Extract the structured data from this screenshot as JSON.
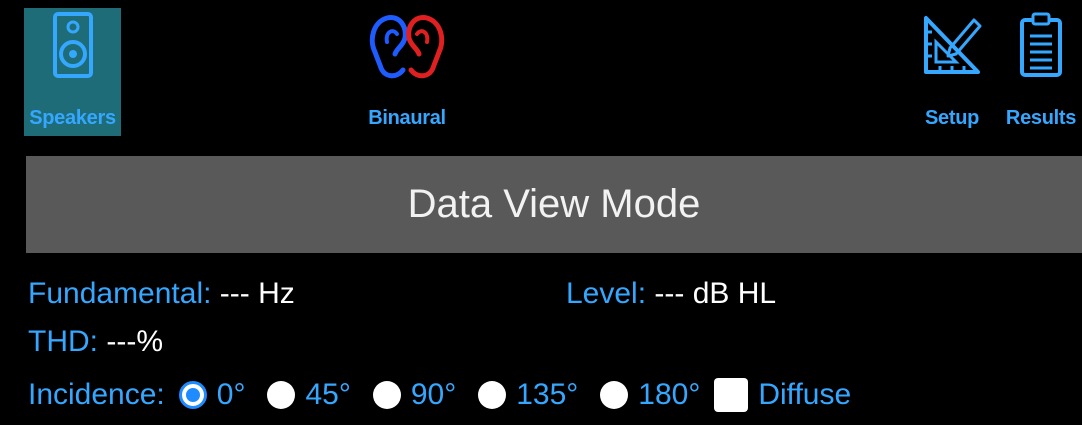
{
  "nav": {
    "speakers": {
      "label": "Speakers",
      "icon": "speaker-icon"
    },
    "binaural": {
      "label": "Binaural",
      "icon": "ears-icon"
    },
    "setup": {
      "label": "Setup",
      "icon": "triangle-ruler-pencil-icon"
    },
    "results": {
      "label": "Results",
      "icon": "clipboard-icon"
    }
  },
  "panel": {
    "title": "Data View Mode",
    "fundamental": {
      "label": "Fundamental:",
      "value": "--- Hz"
    },
    "level": {
      "label": "Level:",
      "value": "--- dB HL"
    },
    "thd": {
      "label": "THD:",
      "value": "---%"
    },
    "incidence": {
      "label": "Incidence:",
      "options": [
        {
          "label": "0°",
          "selected": true
        },
        {
          "label": "45°",
          "selected": false
        },
        {
          "label": "90°",
          "selected": false
        },
        {
          "label": "135°",
          "selected": false
        },
        {
          "label": "180°",
          "selected": false
        }
      ],
      "diffuse": {
        "label": "Diffuse",
        "checked": false
      }
    }
  },
  "colors": {
    "accent": "#35a7ff",
    "active_tab": "#1d6c78",
    "title_bar": "#595959",
    "background": "#000000",
    "radio_selected": "#1e8bff"
  }
}
